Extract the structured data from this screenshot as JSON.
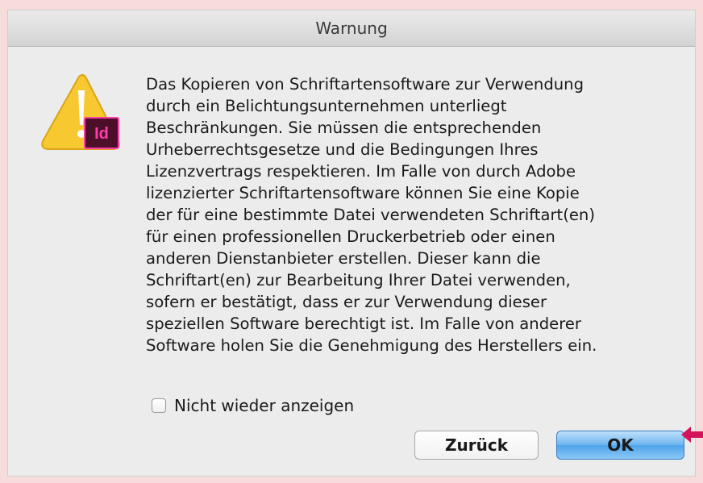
{
  "dialog": {
    "title": "Warnung",
    "app_badge": "Id",
    "message": "Das Kopieren von Schriftartensoftware zur Verwendung\ndurch ein Belichtungsunternehmen unterliegt\nBeschränkungen. Sie müssen die entsprechenden\nUrheberrechtsgesetze und die Bedingungen Ihres\nLizenzvertrags respektieren. Im Falle von durch Adobe\nlizenzierter Schriftartensoftware können Sie eine Kopie\nder für eine bestimmte Datei verwendeten Schriftart(en)\nfür einen professionellen Druckerbetrieb oder einen\nanderen Dienstanbieter erstellen. Dieser kann die\nSchriftart(en) zur Bearbeitung Ihrer Datei verwenden,\nsofern er bestätigt, dass er zur Verwendung dieser\nspeziellen Software berechtigt ist. Im Falle von anderer\nSoftware holen Sie die Genehmigung des Herstellers ein.",
    "checkbox_label": "Nicht wieder anzeigen",
    "checkbox_checked": false,
    "back_button": "Zurück",
    "ok_button": "OK"
  },
  "icons": {
    "warning": "warning-triangle-icon",
    "app": "indesign-app-icon",
    "pointer": "arrow-left-icon"
  },
  "colors": {
    "page_background": "#f7dcdc",
    "warning_yellow": "#f7c830",
    "indesign_badge": "#4b0f2a",
    "indesign_pink": "#ff3fa8",
    "ok_button_blue": "#6db4f1",
    "pointer_red": "#d4145a"
  }
}
